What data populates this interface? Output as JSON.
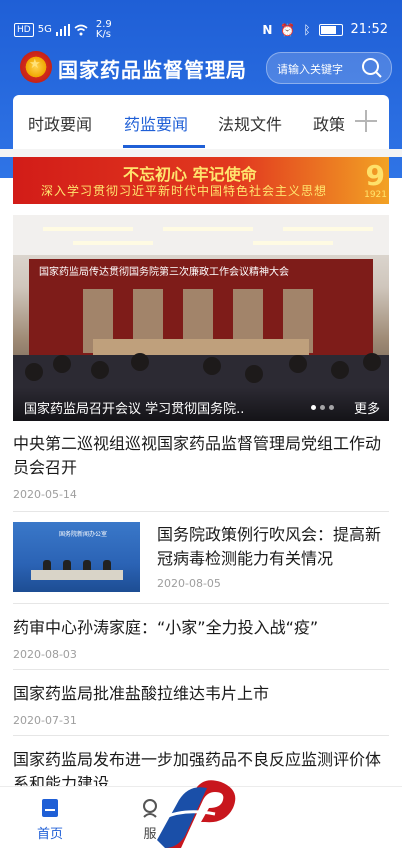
{
  "status_bar": {
    "net_left": "HD",
    "signal_type": "5G",
    "speed_value": "2.9",
    "speed_unit": "K/s",
    "time": "21:52"
  },
  "header": {
    "app_title": "国家药品监督管理局",
    "search_placeholder": "请输入关键字"
  },
  "tabs": [
    {
      "label": "时政要闻",
      "active": false
    },
    {
      "label": "药监要闻",
      "active": true
    },
    {
      "label": "法规文件",
      "active": false
    },
    {
      "label": "政策",
      "active": false
    }
  ],
  "banner": {
    "line1": "不忘初心 牢记使命",
    "line2": "深入学习贯彻习近平新时代中国特色社会主义思想",
    "number": "9",
    "year": "1921"
  },
  "carousel": {
    "stage_text": "国家药监局传达贯彻国务院第三次廉政工作会议精神大会",
    "caption": "国家药监局召开会议 学习贯彻国务院..",
    "more": "更多"
  },
  "news": [
    {
      "title": "中央第二巡视组巡视国家药品监督管理局党组工作动员会召开",
      "date": "2020-05-14"
    },
    {
      "title": "国务院政策例行吹风会：提高新冠病毒检测能力有关情况",
      "date": "2020-08-05",
      "thumb_text": "国务院新闻办公室"
    },
    {
      "title": "药审中心孙涛家庭：“小家”全力投入战“疫”",
      "date": "2020-08-03"
    },
    {
      "title": "国家药监局批准盐酸拉维达韦片上市",
      "date": "2020-07-31"
    },
    {
      "title": "国家药监局发布进一步加强药品不良反应监测评价体系和能力建设",
      "date": ""
    }
  ],
  "bottom_nav": [
    {
      "label": "首页",
      "icon": "home-icon",
      "active": true
    },
    {
      "label": "服",
      "icon": "service-icon",
      "active": false
    }
  ],
  "colors": {
    "primary": "#1f5fd6",
    "accent_red": "#d21c18",
    "text": "#1a1a1a",
    "muted": "#9e9e9e"
  }
}
